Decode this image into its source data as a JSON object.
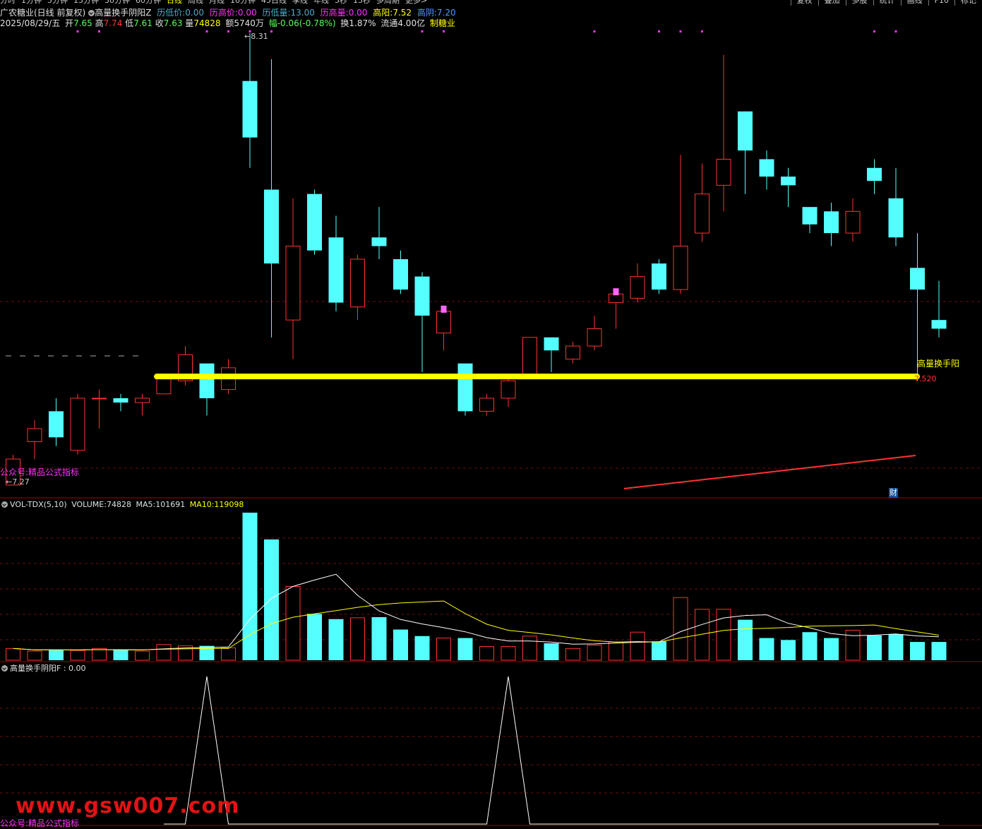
{
  "toolbar": {
    "periods": [
      "分时",
      "1分钟",
      "5分钟",
      "15分钟",
      "30分钟",
      "60分钟",
      "日线",
      "周线",
      "月线",
      "10分钟",
      "45日线",
      "季线",
      "年线",
      "5秒",
      "15秒",
      "多周期",
      "更多>"
    ],
    "active_period": "日线",
    "right_buttons": [
      "复权",
      "叠加",
      "多股",
      "统计",
      "画线",
      "F10",
      "标记"
    ]
  },
  "header": {
    "stock_name": "广农糖业(日线 前复权)",
    "indicator_name": "高量换手阴阳Z",
    "low_price_label": "历低价:",
    "low_price": "0.00",
    "high_price_label": "历高价:",
    "high_price": "0.00",
    "low_vol_label": "历低量:",
    "low_vol": "13.00",
    "high_vol_label": "历高量:",
    "high_vol": "0.00",
    "high_yang_label": "高阳:",
    "high_yang": "7.52",
    "high_yin_label": "高阴:",
    "high_yin": "7.20"
  },
  "quote": {
    "date": "2025/08/29/五",
    "open_label": "开",
    "open": "7.65",
    "high_label": "高",
    "high": "7.74",
    "low_label": "低",
    "low": "7.61",
    "close_label": "收",
    "close": "7.63",
    "vol_label": "量",
    "vol": "74828",
    "amount": "额5740万",
    "change": "幅-0.06(-0.78%)",
    "turnover": "换1.87%",
    "float": "流通4.00亿",
    "sector": "制糖业"
  },
  "main_chart": {
    "max_label": "8.31",
    "min_label": "7.27",
    "level_label": "高量换手阳",
    "level_value": "7.520",
    "cai_badge": "财",
    "note_label": "公众号:精品公式指标"
  },
  "volume_panel": {
    "title": "VOL-TDX(5,10)",
    "volume_label": "VOLUME:",
    "volume": "74828",
    "ma5_label": "MA5:",
    "ma5": "101691",
    "ma10_label": "MA10:",
    "ma10": "119098"
  },
  "indicator_panel": {
    "title": "高量换手阴阳F",
    "value": ": 0.00"
  },
  "watermark": "www.gsw007.com",
  "watermark_note": "公众号:精品公式指标",
  "colors": {
    "up": "#ff3232",
    "down": "#54ffff",
    "highlight": "#ffff00",
    "magenta": "#ff33ff",
    "ma5": "#ffffff",
    "ma10": "#ffff00"
  },
  "chart_data": [
    {
      "type": "candlestick",
      "title": "广农糖业(日线 前复权)",
      "y_range": [
        7.27,
        8.31
      ],
      "level_line": 7.52,
      "candles": [
        {
          "o": 7.27,
          "c": 7.33,
          "h": 7.34,
          "l": 7.27
        },
        {
          "o": 7.37,
          "c": 7.4,
          "h": 7.42,
          "l": 7.33
        },
        {
          "o": 7.44,
          "c": 7.38,
          "h": 7.47,
          "l": 7.36
        },
        {
          "o": 7.35,
          "c": 7.47,
          "h": 7.48,
          "l": 7.34
        },
        {
          "o": 7.47,
          "c": 7.47,
          "h": 7.49,
          "l": 7.4
        },
        {
          "o": 7.47,
          "c": 7.46,
          "h": 7.48,
          "l": 7.44
        },
        {
          "o": 7.46,
          "c": 7.47,
          "h": 7.48,
          "l": 7.43
        },
        {
          "o": 7.48,
          "c": 7.52,
          "h": 7.52,
          "l": 7.48
        },
        {
          "o": 7.51,
          "c": 7.57,
          "h": 7.59,
          "l": 7.5
        },
        {
          "o": 7.55,
          "c": 7.47,
          "h": 7.55,
          "l": 7.43
        },
        {
          "o": 7.49,
          "c": 7.54,
          "h": 7.56,
          "l": 7.48
        },
        {
          "o": 8.2,
          "c": 8.07,
          "h": 8.31,
          "l": 8.0
        },
        {
          "o": 7.95,
          "c": 7.78,
          "h": 8.25,
          "l": 7.61
        },
        {
          "o": 7.65,
          "c": 7.82,
          "h": 7.93,
          "l": 7.56
        },
        {
          "o": 7.94,
          "c": 7.81,
          "h": 7.95,
          "l": 7.8
        },
        {
          "o": 7.84,
          "c": 7.69,
          "h": 7.89,
          "l": 7.67
        },
        {
          "o": 7.68,
          "c": 7.79,
          "h": 7.8,
          "l": 7.65
        },
        {
          "o": 7.84,
          "c": 7.82,
          "h": 7.91,
          "l": 7.79
        },
        {
          "o": 7.79,
          "c": 7.72,
          "h": 7.81,
          "l": 7.71
        },
        {
          "o": 7.75,
          "c": 7.66,
          "h": 7.76,
          "l": 7.53
        },
        {
          "o": 7.62,
          "c": 7.67,
          "h": 7.68,
          "l": 7.58
        },
        {
          "o": 7.55,
          "c": 7.44,
          "h": 7.55,
          "l": 7.43
        },
        {
          "o": 7.44,
          "c": 7.47,
          "h": 7.48,
          "l": 7.43
        },
        {
          "o": 7.47,
          "c": 7.51,
          "h": 7.52,
          "l": 7.45
        },
        {
          "o": 7.52,
          "c": 7.61,
          "h": 7.61,
          "l": 7.52
        },
        {
          "o": 7.61,
          "c": 7.58,
          "h": 7.61,
          "l": 7.53
        },
        {
          "o": 7.56,
          "c": 7.59,
          "h": 7.6,
          "l": 7.55
        },
        {
          "o": 7.59,
          "c": 7.63,
          "h": 7.66,
          "l": 7.58
        },
        {
          "o": 7.69,
          "c": 7.71,
          "h": 7.72,
          "l": 7.63
        },
        {
          "o": 7.7,
          "c": 7.75,
          "h": 7.78,
          "l": 7.69
        },
        {
          "o": 7.78,
          "c": 7.72,
          "h": 7.79,
          "l": 7.71
        },
        {
          "o": 7.72,
          "c": 7.82,
          "h": 8.03,
          "l": 7.71
        },
        {
          "o": 7.85,
          "c": 7.94,
          "h": 8.01,
          "l": 7.83
        },
        {
          "o": 7.96,
          "c": 8.02,
          "h": 8.26,
          "l": 7.9
        },
        {
          "o": 8.13,
          "c": 8.04,
          "h": 8.13,
          "l": 7.94
        },
        {
          "o": 8.02,
          "c": 7.98,
          "h": 8.04,
          "l": 7.95
        },
        {
          "o": 7.98,
          "c": 7.96,
          "h": 8.0,
          "l": 7.91
        },
        {
          "o": 7.91,
          "c": 7.87,
          "h": 7.91,
          "l": 7.85
        },
        {
          "o": 7.9,
          "c": 7.85,
          "h": 7.92,
          "l": 7.82
        },
        {
          "o": 7.85,
          "c": 7.9,
          "h": 7.93,
          "l": 7.83
        },
        {
          "o": 8.0,
          "c": 7.97,
          "h": 8.02,
          "l": 7.94
        },
        {
          "o": 7.93,
          "c": 7.84,
          "h": 8.0,
          "l": 7.82
        },
        {
          "o": 7.77,
          "c": 7.72,
          "h": 7.85,
          "l": 7.51
        },
        {
          "o": 7.65,
          "c": 7.63,
          "h": 7.74,
          "l": 7.61
        }
      ]
    },
    {
      "type": "bar",
      "title": "VOL-TDX(5,10)",
      "series_labels": [
        "VOLUME",
        "MA5",
        "MA10"
      ],
      "values": [
        18000,
        14000,
        16000,
        15000,
        18000,
        16000,
        14000,
        24000,
        22000,
        22000,
        19000,
        226000,
        185000,
        113000,
        71000,
        63000,
        65000,
        66000,
        47000,
        37000,
        34000,
        34000,
        21000,
        21000,
        37000,
        26000,
        18000,
        23000,
        28000,
        43000,
        29000,
        96000,
        78000,
        78000,
        62000,
        34000,
        31000,
        43000,
        34000,
        46000,
        38000,
        40000,
        28000,
        28000
      ]
    },
    {
      "type": "line",
      "title": "高量换手阴阳F",
      "values": [
        0,
        0,
        0,
        0,
        0,
        0,
        0,
        0,
        0,
        1,
        0,
        0,
        0,
        0,
        0,
        0,
        0,
        0,
        0,
        0,
        0,
        0,
        0,
        1,
        0,
        0,
        0,
        0,
        0,
        0,
        0,
        0,
        0,
        0,
        0,
        0,
        0,
        0,
        0,
        0,
        0,
        0,
        0,
        0
      ]
    }
  ]
}
